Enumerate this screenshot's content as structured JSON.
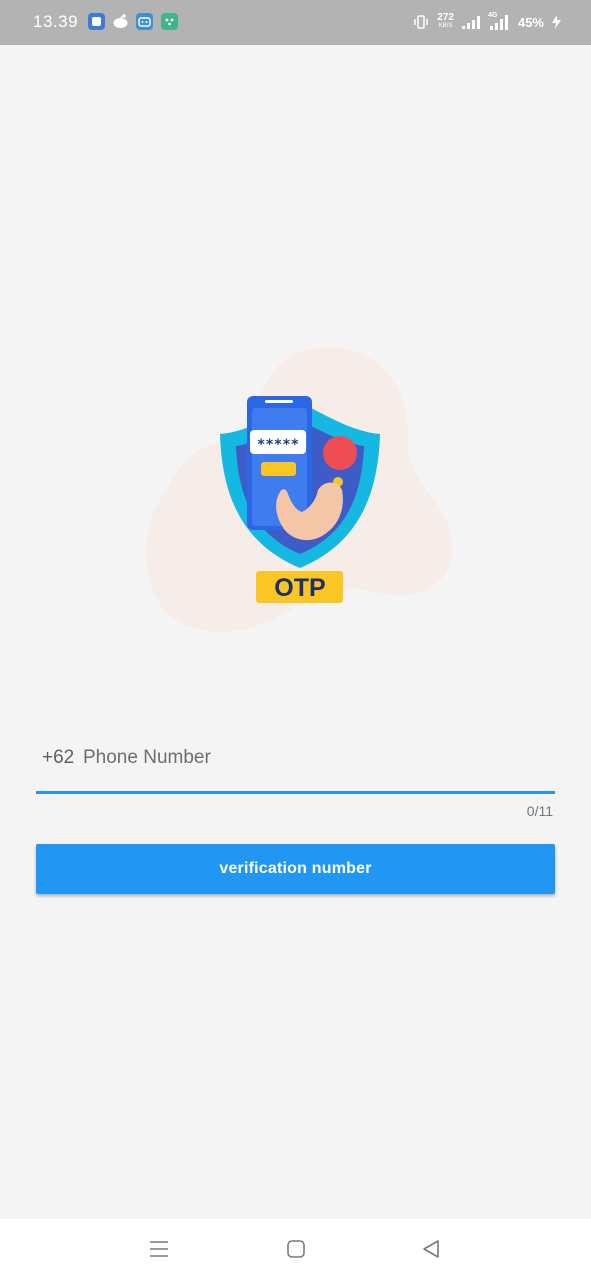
{
  "status_bar": {
    "time": "13.39",
    "network_speed_value": "272",
    "network_speed_unit": "KB/S",
    "network_type": "4G",
    "battery_percent": "45%",
    "notification_icons": [
      "telegram-icon",
      "reddit-icon",
      "bilibili-icon",
      "app-icon"
    ]
  },
  "illustration": {
    "otp_label": "OTP",
    "masked_code": "*****"
  },
  "phone_input": {
    "country_code": "+62",
    "placeholder": "Phone Number",
    "value": "",
    "counter": "0/11"
  },
  "verify_button": {
    "label": "verification number"
  },
  "navigation": {
    "items": [
      "menu-icon",
      "home-icon",
      "back-icon"
    ]
  },
  "colors": {
    "accent": "#2196f3",
    "status_bar": "#b3b3b3",
    "background": "#f4f4f4",
    "otp_badge": "#f9c623"
  }
}
